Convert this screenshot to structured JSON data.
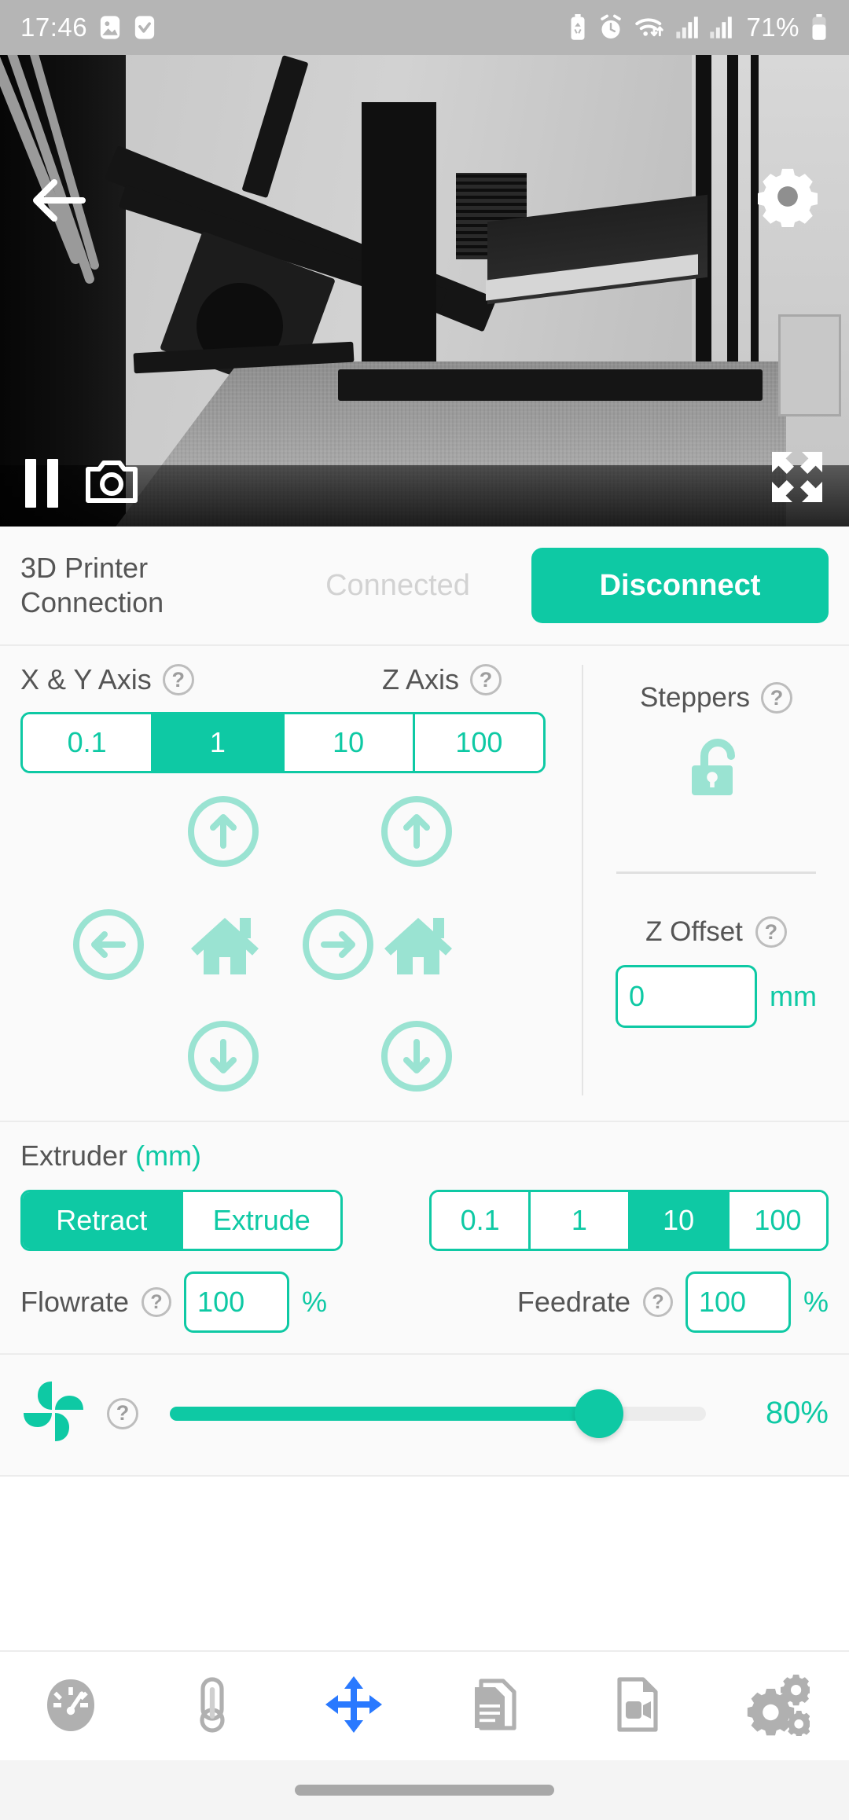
{
  "status_bar": {
    "time": "17:46",
    "battery_percent": "71%",
    "icons": [
      "photo-icon",
      "checkbox-icon",
      "battery-saver-icon",
      "alarm-icon",
      "wifi-icon",
      "signal-1-icon",
      "signal-2-icon",
      "battery-icon"
    ]
  },
  "camera": {
    "back_icon": "back-arrow-icon",
    "settings_icon": "gear-icon",
    "pause_icon": "pause-icon",
    "snapshot_icon": "camera-icon",
    "fullscreen_icon": "fullscreen-expand-icon",
    "feed_description": "3D printer webcam live feed, grayscale"
  },
  "connection": {
    "title": "3D Printer\nConnection",
    "title_line1": "3D Printer",
    "title_line2": "Connection",
    "status": "Connected",
    "button_label": "Disconnect"
  },
  "move": {
    "xy_axis_label": "X & Y Axis",
    "z_axis_label": "Z Axis",
    "help_glyph": "?",
    "step_options": [
      "0.1",
      "1",
      "10",
      "100"
    ],
    "selected_step": "1",
    "xy_buttons": [
      "up-arrow",
      "left-arrow",
      "home",
      "right-arrow",
      "down-arrow"
    ],
    "z_buttons": [
      "up-arrow",
      "home",
      "down-arrow"
    ]
  },
  "steppers": {
    "label": "Steppers",
    "lock_state": "unlocked",
    "lock_icon": "padlock-open-icon"
  },
  "z_offset": {
    "label": "Z Offset",
    "value": "0",
    "unit": "mm"
  },
  "extruder": {
    "title": "Extruder",
    "unit_suffix": "(mm)",
    "mode_options": [
      "Retract",
      "Extrude"
    ],
    "selected_mode": "Retract",
    "step_options": [
      "0.1",
      "1",
      "10",
      "100"
    ],
    "selected_step": "10",
    "flowrate": {
      "label": "Flowrate",
      "value": "100",
      "unit": "%"
    },
    "feedrate": {
      "label": "Feedrate",
      "value": "100",
      "unit": "%"
    }
  },
  "fan": {
    "icon": "fan-pinwheel-icon",
    "value": "80%",
    "percent": 80
  },
  "bottom_nav": {
    "items": [
      {
        "name": "dashboard",
        "icon": "gauge-icon",
        "active": false
      },
      {
        "name": "temperature",
        "icon": "thermometer-icon",
        "active": false
      },
      {
        "name": "move",
        "icon": "move-arrows-icon",
        "active": true
      },
      {
        "name": "files",
        "icon": "documents-icon",
        "active": false
      },
      {
        "name": "video",
        "icon": "video-file-icon",
        "active": false
      },
      {
        "name": "settings",
        "icon": "gears-icon",
        "active": false
      }
    ],
    "active_color": "#2979ff",
    "inactive_color": "#b0b0b0"
  },
  "colors": {
    "accent": "#0ec9a4",
    "accent_light": "#9ae3d2",
    "panel_bg": "#fafafa",
    "status_bar_bg": "#b5b5b5",
    "muted_text": "#555555",
    "disabled_text": "#d2d2d2"
  }
}
